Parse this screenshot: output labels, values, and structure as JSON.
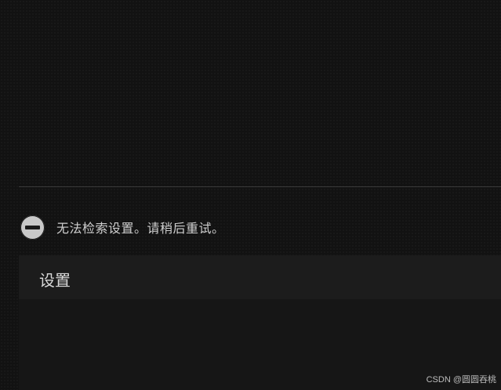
{
  "error": {
    "icon": "minus-circle-icon",
    "message": "无法检索设置。请稍后重试。"
  },
  "settings": {
    "title": "设置"
  },
  "watermark": {
    "text": "CSDN @圆圆吞桃"
  },
  "colors": {
    "background": "#121212",
    "panel": "#1c1c1c",
    "text": "#cfcfcf",
    "icon": "#c9c9c9"
  }
}
